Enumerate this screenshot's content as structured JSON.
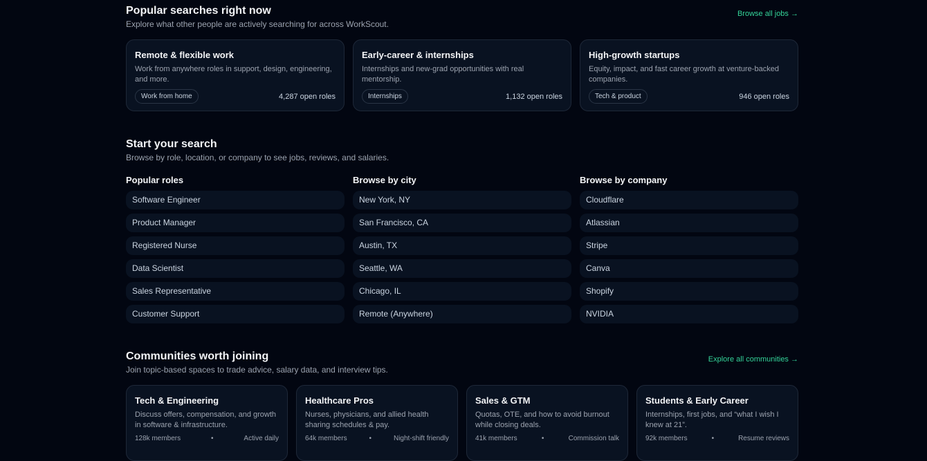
{
  "popular": {
    "title": "Popular searches right now",
    "subtitle": "Explore what other people are actively searching for across WorkScout.",
    "link": "Browse all jobs →",
    "cards": [
      {
        "title": "Remote & flexible work",
        "desc": "Work from anywhere roles in support, design, engineering, and more.",
        "chip": "Work from home",
        "count": "4,287 open roles"
      },
      {
        "title": "Early-career & internships",
        "desc": "Internships and new-grad opportunities with real mentorship.",
        "chip": "Internships",
        "count": "1,132 open roles"
      },
      {
        "title": "High-growth startups",
        "desc": "Equity, impact, and fast career growth at venture-backed companies.",
        "chip": "Tech & product",
        "count": "946 open roles"
      }
    ]
  },
  "start": {
    "title": "Start your search",
    "subtitle": "Browse by role, location, or company to see jobs, reviews, and salaries.",
    "columns": [
      {
        "title": "Popular roles",
        "items": [
          "Software Engineer",
          "Product Manager",
          "Registered Nurse",
          "Data Scientist",
          "Sales Representative",
          "Customer Support"
        ]
      },
      {
        "title": "Browse by city",
        "items": [
          "New York, NY",
          "San Francisco, CA",
          "Austin, TX",
          "Seattle, WA",
          "Chicago, IL",
          "Remote (Anywhere)"
        ]
      },
      {
        "title": "Browse by company",
        "items": [
          "Cloudflare",
          "Atlassian",
          "Stripe",
          "Canva",
          "Shopify",
          "NVIDIA"
        ]
      }
    ]
  },
  "communities": {
    "title": "Communities worth joining",
    "subtitle": "Join topic-based spaces to trade advice, salary data, and interview tips.",
    "link": "Explore all communities →",
    "cards": [
      {
        "title": "Tech & Engineering",
        "desc": "Discuss offers, compensation, and growth in software & infrastructure.",
        "members": "128k members",
        "dot": "•",
        "tag": "Active daily"
      },
      {
        "title": "Healthcare Pros",
        "desc": "Nurses, physicians, and allied health sharing schedules & pay.",
        "members": "64k members",
        "dot": "•",
        "tag": "Night-shift friendly"
      },
      {
        "title": "Sales & GTM",
        "desc": "Quotas, OTE, and how to avoid burnout while closing deals.",
        "members": "41k members",
        "dot": "•",
        "tag": "Commission talk"
      },
      {
        "title": "Students & Early Career",
        "desc": "Internships, first jobs, and “what I wish I knew at 21”.",
        "members": "92k members",
        "dot": "•",
        "tag": "Resume reviews"
      }
    ]
  }
}
